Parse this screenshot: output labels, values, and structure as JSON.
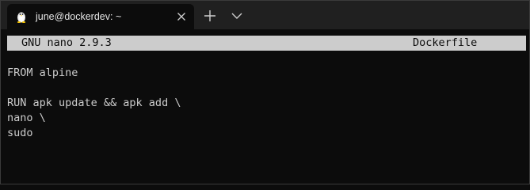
{
  "tab": {
    "title": "june@dockerdev: ~",
    "icon": "linux-penguin-icon"
  },
  "tab_actions": {
    "new_tab_icon": "plus-icon",
    "dropdown_icon": "chevron-down-icon"
  },
  "nano": {
    "version": "GNU nano 2.9.3",
    "filename": "Dockerfile"
  },
  "editor": {
    "lines": [
      "FROM alpine",
      "",
      "RUN apk update && apk add \\",
      "nano \\",
      "sudo"
    ]
  },
  "colors": {
    "terminal_bg": "#0c0c0c",
    "titlebar_bg": "#202020",
    "text": "#cccccc",
    "header_bg": "#cccccc"
  }
}
